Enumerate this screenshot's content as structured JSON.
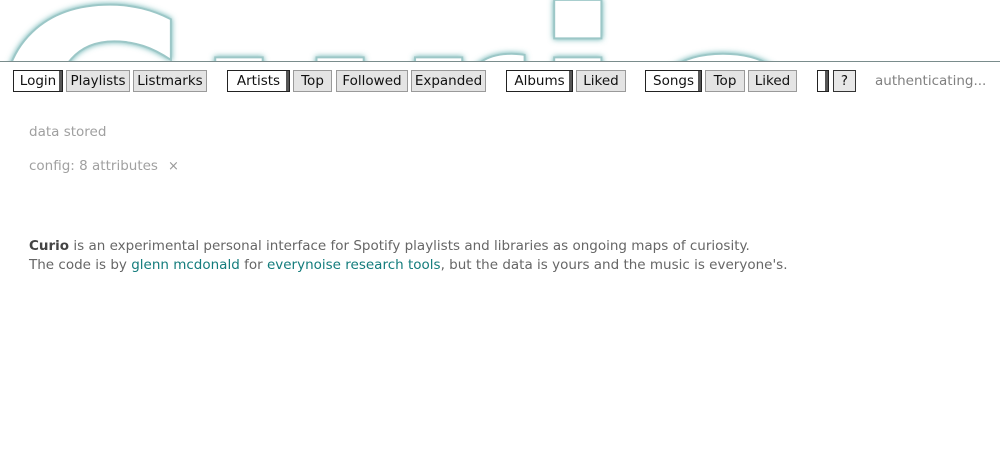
{
  "banner": {
    "logo_text": "Curio"
  },
  "toolbar": {
    "login": "Login",
    "playlists": "Playlists",
    "listmarks": "Listmarks",
    "artists": "Artists",
    "artists_top": "Top",
    "followed": "Followed",
    "expanded": "Expanded",
    "albums": "Albums",
    "albums_liked": "Liked",
    "songs": "Songs",
    "songs_top": "Top",
    "songs_liked": "Liked",
    "blank": "",
    "help": "?",
    "status": "authenticating..."
  },
  "info": {
    "data_stored": "data stored",
    "config": "config: 8 attributes",
    "config_close": "×"
  },
  "about": {
    "brand": "Curio",
    "line1_rest": " is an experimental personal interface for Spotify playlists and libraries as ongoing maps of curiosity.",
    "line2_start": "The code is by ",
    "author_link": "glenn mcdonald",
    "line2_mid": " for ",
    "tools_link": "everynoise research tools",
    "line2_end": ", but the data is yours and the music is everyone's."
  }
}
